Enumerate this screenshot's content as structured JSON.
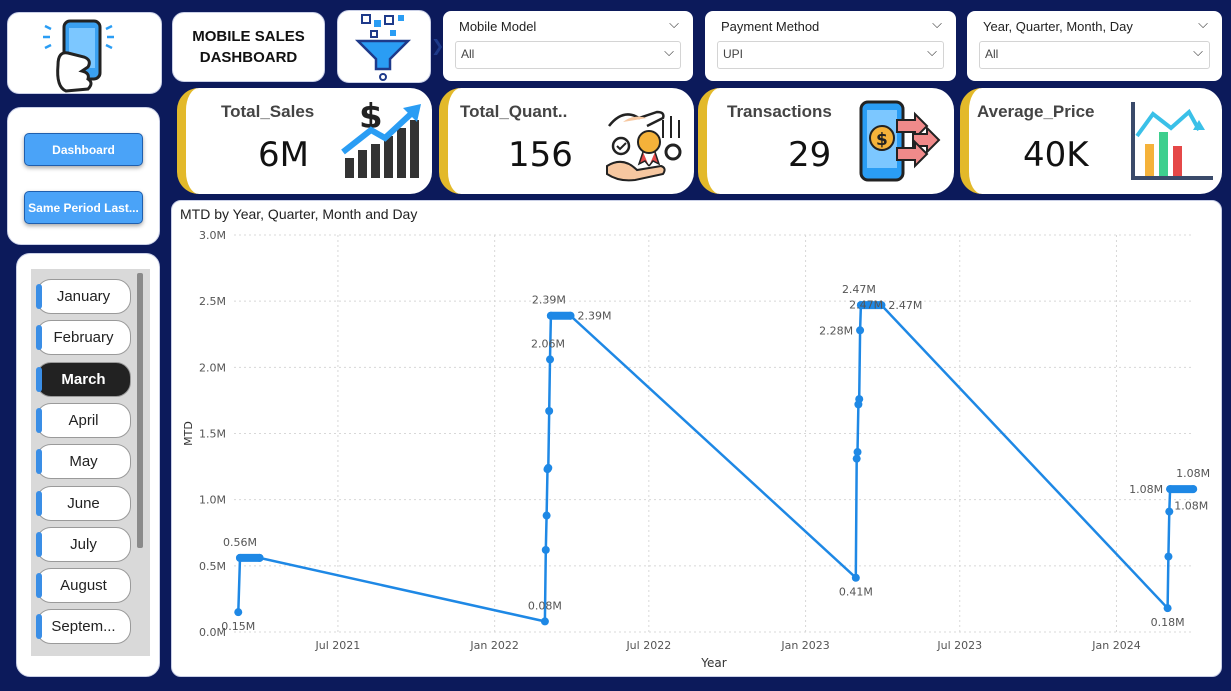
{
  "header": {
    "title": "MOBILE SALES\nDASHBOARD"
  },
  "filters": [
    {
      "label": "Mobile Model",
      "value": "All"
    },
    {
      "label": "Payment Method",
      "value": "UPI"
    },
    {
      "label": "Year, Quarter, Month, Day",
      "value": "All"
    }
  ],
  "nav": {
    "dashboard": "Dashboard",
    "same_period": "Same Period Last..."
  },
  "months": [
    "January",
    "February",
    "March",
    "April",
    "May",
    "June",
    "July",
    "August",
    "Septem..."
  ],
  "selected_month": "March",
  "kpis": [
    {
      "label": "Total_Sales",
      "value": "6M"
    },
    {
      "label": "Total_Quant..",
      "value": "156"
    },
    {
      "label": "Transactions",
      "value": "29"
    },
    {
      "label": "Average_Price",
      "value": "40K"
    }
  ],
  "colors": {
    "accent": "#e3b92a",
    "background": "#0c1a5b",
    "line": "#1e88e5",
    "button": "#4aa3f8"
  },
  "chart_data": {
    "type": "line",
    "title": "MTD by Year, Quarter, Month and Day",
    "xlabel": "Year",
    "ylabel": "MTD",
    "ylim": [
      0,
      3.0
    ],
    "y_unit": "M",
    "y_ticks": [
      "0.0M",
      "0.5M",
      "1.0M",
      "1.5M",
      "2.0M",
      "2.5M",
      "3.0M"
    ],
    "x_ticks": [
      "Jul 2021",
      "Jan 2022",
      "Jul 2022",
      "Jan 2023",
      "Jul 2023",
      "Jan 2024"
    ],
    "x_range": [
      "2021-03-01",
      "2024-04-01"
    ],
    "grid": true,
    "series": [
      {
        "points": [
          {
            "x": "2021-03-06",
            "y": 0.15
          },
          {
            "x": "2021-03-08",
            "y": 0.56
          },
          {
            "x": "2021-03-31",
            "y": 0.56
          },
          {
            "x": "2022-03-01",
            "y": 0.08
          },
          {
            "x": "2022-03-02",
            "y": 0.62
          },
          {
            "x": "2022-03-03",
            "y": 0.88
          },
          {
            "x": "2022-03-04",
            "y": 1.23
          },
          {
            "x": "2022-03-05",
            "y": 1.24
          },
          {
            "x": "2022-03-06",
            "y": 1.67
          },
          {
            "x": "2022-03-07",
            "y": 2.06
          },
          {
            "x": "2022-03-08",
            "y": 2.39
          },
          {
            "x": "2022-03-31",
            "y": 2.39
          },
          {
            "x": "2023-03-01",
            "y": 0.41
          },
          {
            "x": "2023-03-02",
            "y": 1.31
          },
          {
            "x": "2023-03-03",
            "y": 1.36
          },
          {
            "x": "2023-03-04",
            "y": 1.72
          },
          {
            "x": "2023-03-05",
            "y": 1.76
          },
          {
            "x": "2023-03-06",
            "y": 2.28
          },
          {
            "x": "2023-03-07",
            "y": 2.47
          },
          {
            "x": "2023-03-31",
            "y": 2.47
          },
          {
            "x": "2024-03-01",
            "y": 0.18
          },
          {
            "x": "2024-03-02",
            "y": 0.57
          },
          {
            "x": "2024-03-03",
            "y": 0.91
          },
          {
            "x": "2024-03-04",
            "y": 1.08
          },
          {
            "x": "2024-03-31",
            "y": 1.08
          }
        ]
      }
    ],
    "data_labels": [
      {
        "x": "2021-03-06",
        "y": 0.15,
        "text": "0.15M",
        "pos": "below"
      },
      {
        "x": "2021-03-08",
        "y": 0.56,
        "text": "0.56M",
        "pos": "above"
      },
      {
        "x": "2022-03-01",
        "y": 0.08,
        "text": "0.08M",
        "pos": "above"
      },
      {
        "x": "2022-03-07",
        "y": 2.06,
        "text": "2.06M",
        "pos": "above-left"
      },
      {
        "x": "2022-03-08",
        "y": 2.39,
        "text": "2.39M",
        "pos": "above-left"
      },
      {
        "x": "2022-03-31",
        "y": 2.39,
        "text": "2.39M",
        "pos": "right"
      },
      {
        "x": "2023-03-01",
        "y": 0.41,
        "text": "0.41M",
        "pos": "below"
      },
      {
        "x": "2023-03-06",
        "y": 2.28,
        "text": "2.28M",
        "pos": "left"
      },
      {
        "x": "2023-03-07",
        "y": 2.47,
        "text": "2.47M",
        "pos": "above-left"
      },
      {
        "x": "2023-03-06",
        "y": 2.28,
        "text": "2.47M",
        "pos": "above-small"
      },
      {
        "x": "2023-03-31",
        "y": 2.47,
        "text": "2.47M",
        "pos": "right"
      },
      {
        "x": "2024-03-01",
        "y": 0.18,
        "text": "0.18M",
        "pos": "below"
      },
      {
        "x": "2024-03-04",
        "y": 1.08,
        "text": "1.08M",
        "pos": "left"
      },
      {
        "x": "2024-03-03",
        "y": 0.91,
        "text": "1.08M",
        "pos": "right-small"
      },
      {
        "x": "2024-03-31",
        "y": 1.08,
        "text": "1.08M",
        "pos": "above"
      }
    ]
  }
}
